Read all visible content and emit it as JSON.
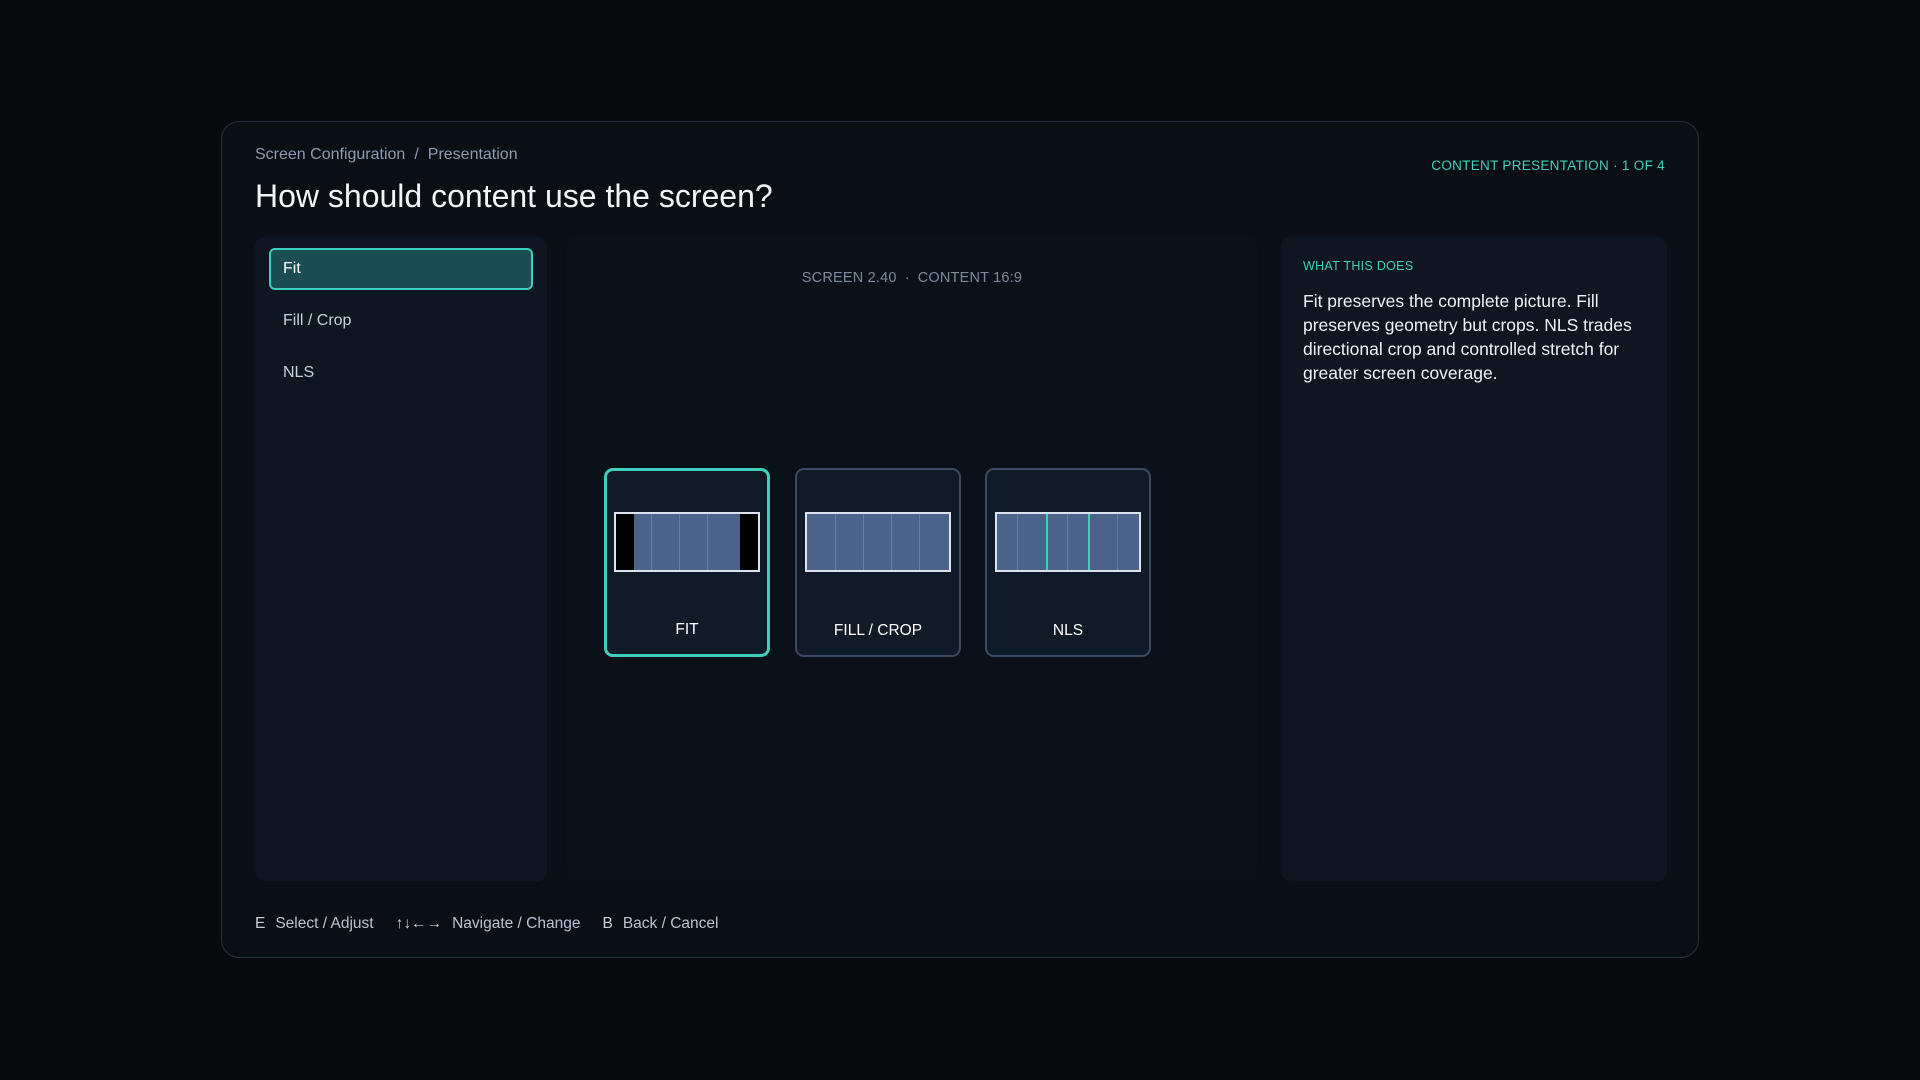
{
  "breadcrumb": {
    "items": [
      "Screen Configuration",
      "Presentation"
    ],
    "separator": "/"
  },
  "step_indicator": "CONTENT PRESENTATION · 1 OF 4",
  "title": "How should content use the screen?",
  "sidebar": {
    "items": [
      {
        "label": "Fit",
        "selected": true
      },
      {
        "label": "Fill / Crop",
        "selected": false
      },
      {
        "label": "NLS",
        "selected": false
      }
    ]
  },
  "preview": {
    "screen_label": "SCREEN 2.40",
    "separator": "·",
    "content_label": "CONTENT 16:9",
    "cards": [
      {
        "label": "FIT",
        "selected": true,
        "thumb_icon": "letterbox-fit-icon"
      },
      {
        "label": "FILL / CROP",
        "selected": false,
        "thumb_icon": "fill-crop-icon"
      },
      {
        "label": "NLS",
        "selected": false,
        "thumb_icon": "nonlinear-stretch-icon"
      }
    ]
  },
  "info": {
    "heading": "WHAT THIS DOES",
    "body": "Fit preserves the complete picture. Fill preserves geometry but crops. NLS trades directional crop and controlled stretch for greater screen coverage."
  },
  "hints": [
    {
      "key": "E",
      "label": "Select / Adjust"
    },
    {
      "key": "↑↓←→",
      "label": "Navigate / Change"
    },
    {
      "key": "B",
      "label": "Back / Cancel"
    }
  ],
  "colors": {
    "accent": "#3fd0bb",
    "selected_item_bg": "#1c4d52",
    "panel_bg": "#0e1622",
    "page_bg": "#07090d",
    "thumb_fill": "#4b6388"
  }
}
